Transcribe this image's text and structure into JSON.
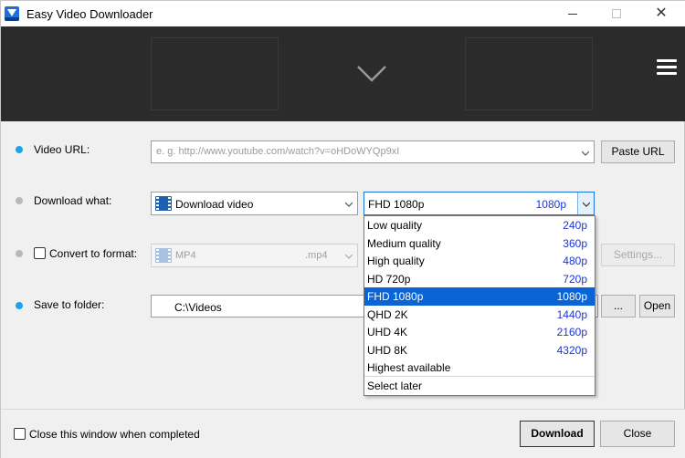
{
  "window": {
    "title": "Easy Video Downloader",
    "min_glyph": "",
    "close_glyph": "✕"
  },
  "video_url": {
    "label": "Video URL:",
    "placeholder": "e. g. http://www.youtube.com/watch?v=oHDoWYQp9xI",
    "paste_button": "Paste URL"
  },
  "download_what": {
    "label": "Download what:",
    "value": "Download video",
    "quality_value": "FHD 1080p",
    "quality_res": "1080p"
  },
  "quality_options": [
    {
      "name": "Low quality",
      "res": "240p"
    },
    {
      "name": "Medium quality",
      "res": "360p"
    },
    {
      "name": "High quality",
      "res": "480p"
    },
    {
      "name": "HD 720p",
      "res": "720p"
    },
    {
      "name": "FHD 1080p",
      "res": "1080p",
      "selected": true
    },
    {
      "name": "QHD 2K",
      "res": "1440p"
    },
    {
      "name": "UHD 4K",
      "res": "2160p"
    },
    {
      "name": "UHD 8K",
      "res": "4320p"
    },
    {
      "name": "Highest available",
      "res": ""
    },
    {
      "name": "Select later",
      "res": ""
    }
  ],
  "convert": {
    "label": "Convert to format:",
    "format": "MP4",
    "ext": ".mp4",
    "settings_button": "Settings..."
  },
  "save_folder": {
    "label": "Save to folder:",
    "value": "C:\\Videos",
    "browse_button": "...",
    "open_button": "Open"
  },
  "footer": {
    "close_when_completed": "Close this window when completed",
    "download_button": "Download",
    "close_button": "Close"
  },
  "colors": {
    "accent": "#1fa3e8",
    "selection": "#0a64d6",
    "resolution_text": "#1b34d8",
    "banner": "#2b2b2b"
  }
}
